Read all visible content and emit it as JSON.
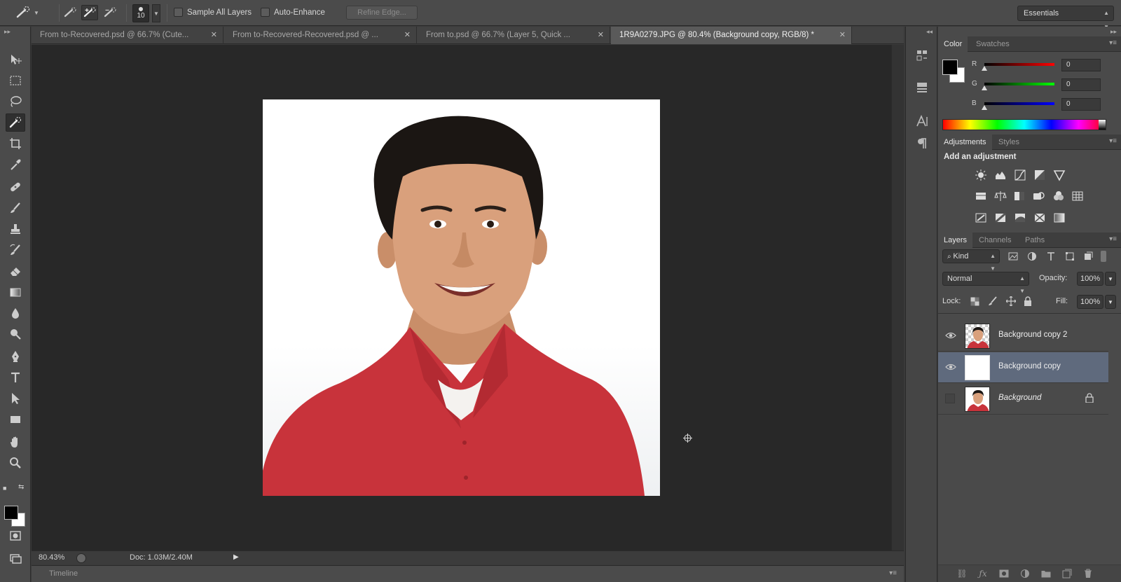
{
  "options": {
    "brush_size": "10",
    "sample_all_layers": "Sample All Layers",
    "auto_enhance": "Auto-Enhance",
    "refine_edge": "Refine Edge...",
    "workspace": "Essentials"
  },
  "tabs": [
    {
      "title": "From to-Recovered.psd @ 66.7% (Cute..."
    },
    {
      "title": "From to-Recovered-Recovered.psd @ ..."
    },
    {
      "title": "From to.psd @ 66.7% (Layer 5, Quick ..."
    },
    {
      "title": "1R9A0279.JPG @ 80.4% (Background copy, RGB/8) *"
    }
  ],
  "status": {
    "zoom": "80.43%",
    "doc_size": "Doc: 1.03M/2.40M",
    "timeline": "Timeline"
  },
  "color_panel": {
    "tabs": [
      "Color",
      "Swatches"
    ],
    "r_label": "R",
    "g_label": "G",
    "b_label": "B",
    "r": "0",
    "g": "0",
    "b": "0",
    "foreground": "#000000",
    "background": "#ffffff"
  },
  "adjustments": {
    "tabs": [
      "Adjustments",
      "Styles"
    ],
    "title": "Add an adjustment"
  },
  "layers_panel": {
    "tabs": [
      "Layers",
      "Channels",
      "Paths"
    ],
    "kind": "Kind",
    "blend_mode": "Normal",
    "opacity_label": "Opacity:",
    "opacity": "100%",
    "lock_label": "Lock:",
    "fill_label": "Fill:",
    "fill": "100%",
    "layers": [
      {
        "name": "Background copy 2",
        "visible": true,
        "selected": false
      },
      {
        "name": "Background copy",
        "visible": true,
        "selected": true
      },
      {
        "name": "Background",
        "visible": false,
        "selected": false
      }
    ]
  },
  "colors": {
    "shirt": "#c8333b",
    "skin": "#d9a07c",
    "hair": "#1b1613",
    "selected_layer": "#5f6a7d"
  }
}
